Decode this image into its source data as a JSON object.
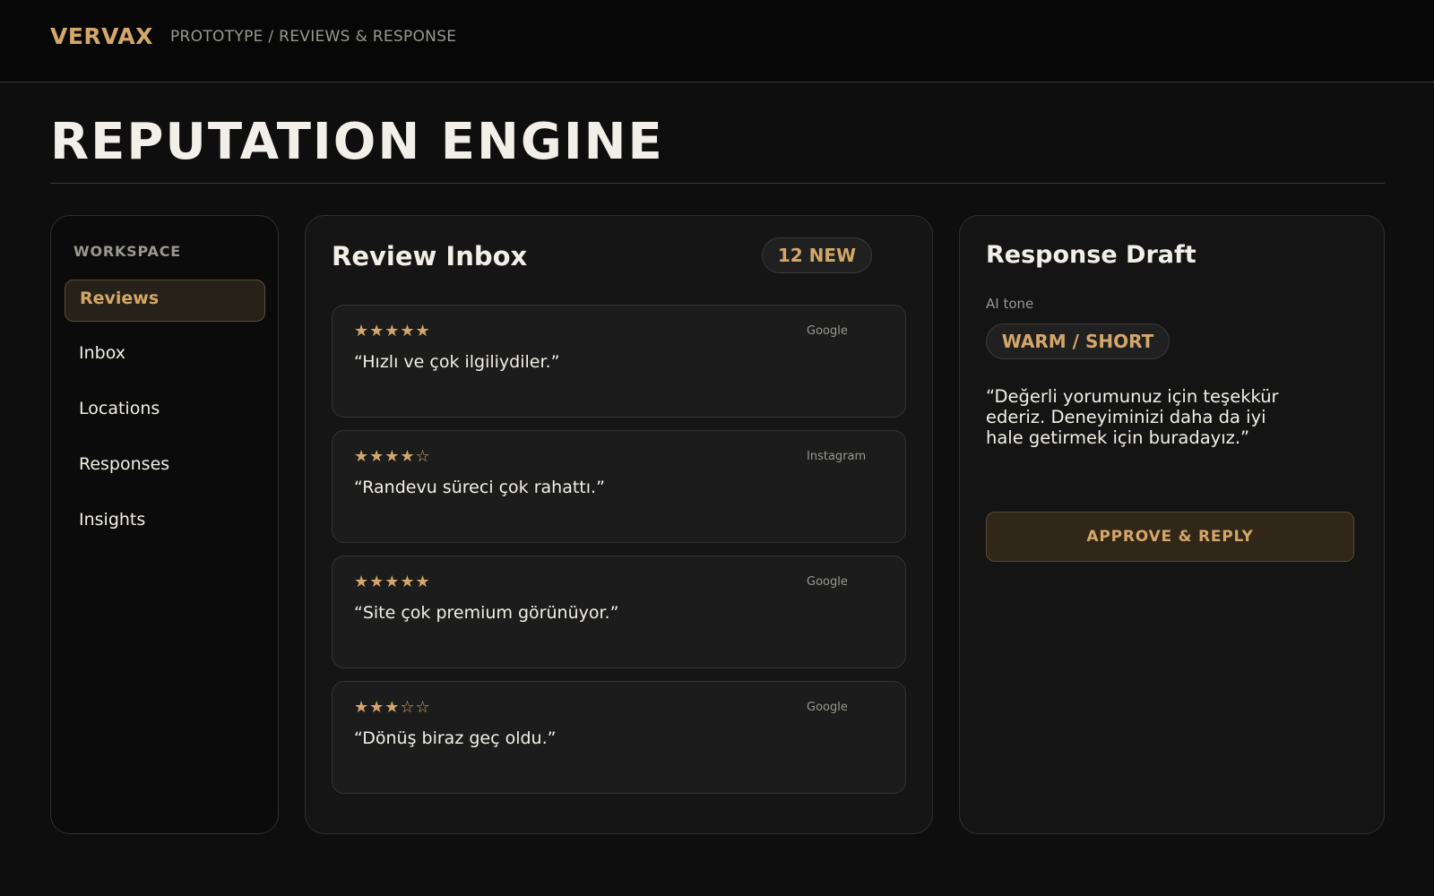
{
  "header": {
    "brand": "VERVAX",
    "breadcrumb": "PROTOTYPE / REVIEWS & RESPONSE"
  },
  "page": {
    "title": "REPUTATION ENGINE"
  },
  "sidebar": {
    "section_label": "WORKSPACE",
    "items": [
      {
        "label": "Reviews",
        "active": true
      },
      {
        "label": "Inbox",
        "active": false
      },
      {
        "label": "Locations",
        "active": false
      },
      {
        "label": "Responses",
        "active": false
      },
      {
        "label": "Insights",
        "active": false
      }
    ]
  },
  "inbox": {
    "title": "Review Inbox",
    "badge": "12 NEW",
    "reviews": [
      {
        "stars": "★★★★★",
        "rating": 5,
        "source": "Google",
        "quote": "“Hızlı ve çok ilgiliydiler.”"
      },
      {
        "stars": "★★★★☆",
        "rating": 4,
        "source": "Instagram",
        "quote": "“Randevu süreci çok rahattı.”"
      },
      {
        "stars": "★★★★★",
        "rating": 5,
        "source": "Google",
        "quote": "“Site çok premium görünüyor.”"
      },
      {
        "stars": "★★★☆☆",
        "rating": 3,
        "source": "Google",
        "quote": "“Dönüş biraz geç oldu.”"
      }
    ]
  },
  "draft": {
    "title": "Response Draft",
    "tone_label": "AI tone",
    "tone_value": "WARM / SHORT",
    "lines": [
      "“Değerli yorumunuz için teşekkür",
      "ederiz. Deneyiminizi daha da iyi",
      "hale getirmek için buradayız.”"
    ],
    "approve_label": "APPROVE & REPLY"
  },
  "colors": {
    "accent": "#d4a66a",
    "background": "#0e0e0e",
    "text": "#f2efe8",
    "muted": "#9a9790"
  }
}
